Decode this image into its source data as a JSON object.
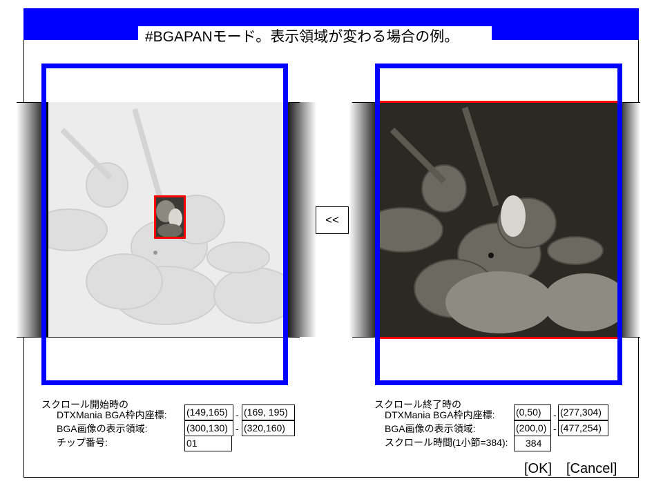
{
  "title": "#BGAPANモード。表示領域が変わる場合の例。",
  "swap_button_label": "<<",
  "start": {
    "heading": "スクロール開始時の",
    "frame_label": "DTXMania BGA枠内座標:",
    "frame_from": "(149,165)",
    "frame_to": "(169, 195)",
    "area_label": "BGA画像の表示領域:",
    "area_from": "(300,130)",
    "area_to": "(320,160)",
    "chip_label": "チップ番号:",
    "chip_value": "01"
  },
  "end": {
    "heading": "スクロール終了時の",
    "frame_label": "DTXMania BGA枠内座標:",
    "frame_from": "(0,50)",
    "frame_to": "(277,304)",
    "area_label": "BGA画像の表示領域:",
    "area_from": "(200,0)",
    "area_to": "(477,254)",
    "time_label": "スクロール時間(1小節=384):",
    "time_value": "384"
  },
  "separator": "-",
  "buttons": {
    "ok": "[OK]",
    "cancel": "[Cancel]"
  },
  "colors": {
    "header": "#0000ff",
    "frame": "#0000ff",
    "highlight": "#ff0000"
  }
}
